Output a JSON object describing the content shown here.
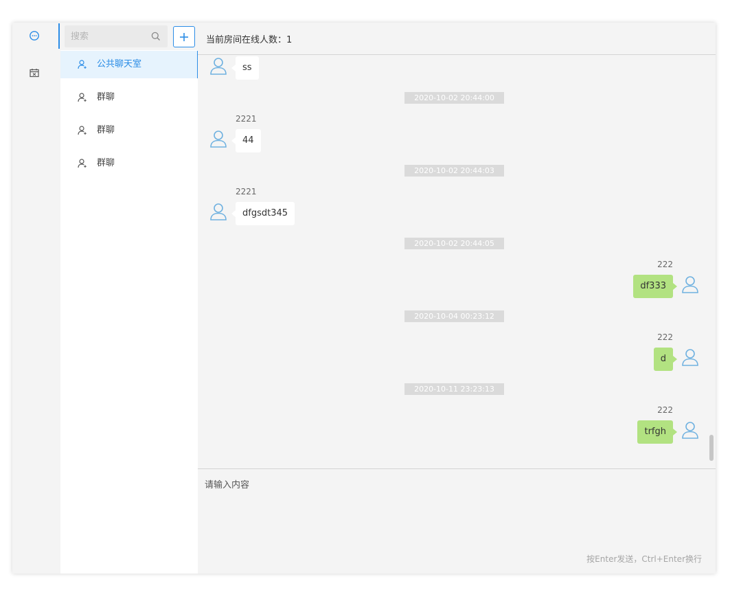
{
  "nav": {
    "items": [
      {
        "icon": "chat-bubble-icon",
        "active": true
      },
      {
        "icon": "calendar-icon",
        "active": false
      }
    ]
  },
  "search": {
    "placeholder": "搜索"
  },
  "contacts": [
    {
      "name": "公共聊天室",
      "active": true
    },
    {
      "name": "群聊",
      "active": false
    },
    {
      "name": "群聊",
      "active": false
    },
    {
      "name": "群聊",
      "active": false
    }
  ],
  "header": {
    "online_label": "当前房间在线人数：1"
  },
  "messages": [
    {
      "type": "msg",
      "side": "left",
      "sender": "",
      "text": "ss"
    },
    {
      "type": "time",
      "text": "2020-10-02 20:44:00"
    },
    {
      "type": "msg",
      "side": "left",
      "sender": "2221",
      "text": "44"
    },
    {
      "type": "time",
      "text": "2020-10-02 20:44:03"
    },
    {
      "type": "msg",
      "side": "left",
      "sender": "2221",
      "text": "dfgsdt345"
    },
    {
      "type": "time",
      "text": "2020-10-02 20:44:05"
    },
    {
      "type": "msg",
      "side": "right",
      "sender": "222",
      "text": "df333"
    },
    {
      "type": "time",
      "text": "2020-10-04 00:23:12"
    },
    {
      "type": "msg",
      "side": "right",
      "sender": "222",
      "text": "d"
    },
    {
      "type": "time",
      "text": "2020-10-11 23:23:13"
    },
    {
      "type": "msg",
      "side": "right",
      "sender": "222",
      "text": "trfgh"
    }
  ],
  "input": {
    "placeholder": "请输入内容",
    "hint": "按Enter发送，Ctrl+Enter换行"
  },
  "colors": {
    "accent": "#2a8ce6",
    "own_bubble": "#b2e281",
    "other_bubble": "#ffffff",
    "avatar": "#6fb1e0",
    "timestamp_bg": "#dadada"
  }
}
